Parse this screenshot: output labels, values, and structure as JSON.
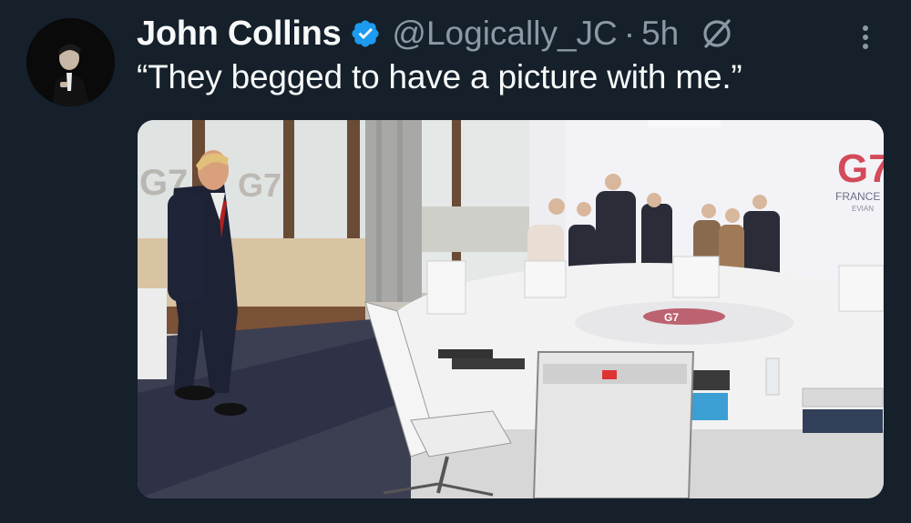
{
  "tweet": {
    "author_name": "John Collins",
    "handle": "@Logically_JC",
    "separator": "·",
    "timestamp": "5h",
    "text": "“They begged to have a picture with me.”"
  },
  "icons": {
    "verified": "verified-badge-icon",
    "grok": "grok-icon",
    "more": "more-options-icon"
  },
  "media": {
    "backdrop_logo": "G7",
    "sign_text": "FRANCE",
    "sign_sub": "EVIAN",
    "table_logo": "G7"
  },
  "colors": {
    "background": "#15202b",
    "primary_text": "#f7f9f9",
    "secondary_text": "#8b98a5",
    "verified_blue": "#1d9bf0"
  }
}
